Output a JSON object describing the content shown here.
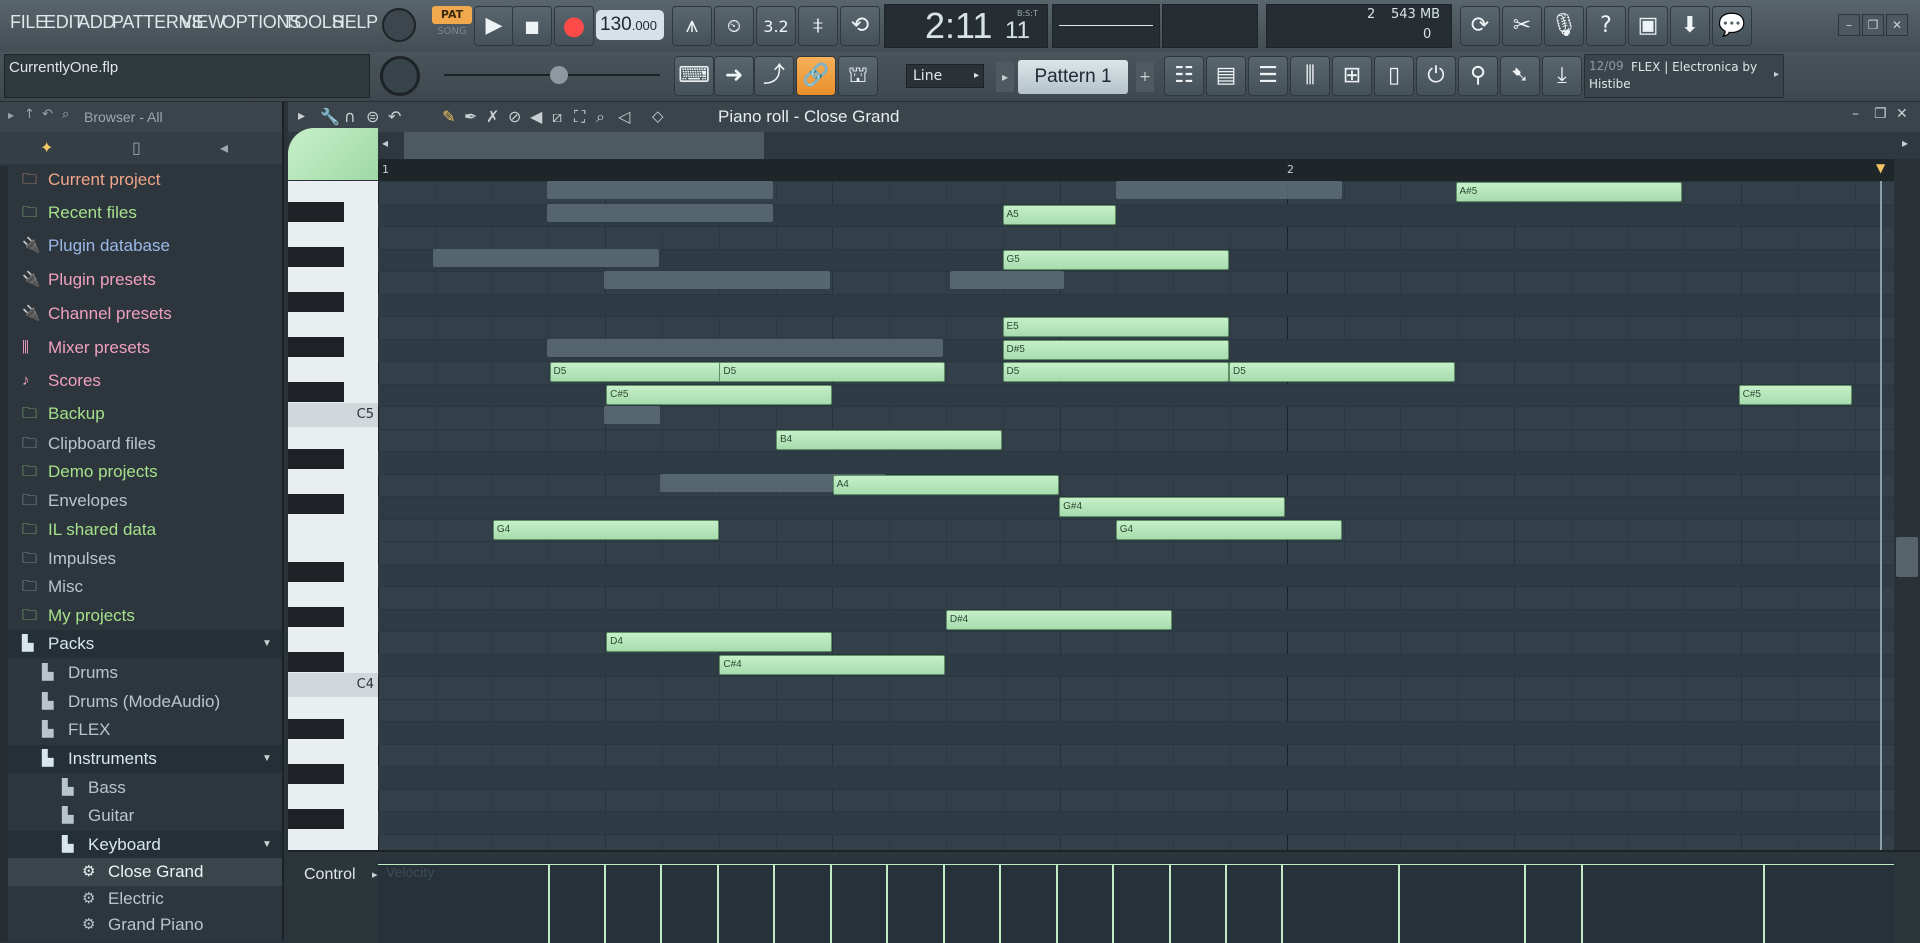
{
  "menu": [
    "FILE",
    "EDIT",
    "ADD",
    "PATTERNS",
    "VIEW",
    "OPTIONS",
    "TOOLS",
    "HELP"
  ],
  "transport": {
    "pat_label": "PAT",
    "song_label": "SONG",
    "tempo": "130",
    "tempo_decimals": ".000",
    "time": "2:11",
    "time_ticks": "11",
    "time_unit": "B:S:T"
  },
  "cpu": {
    "polyphony": "2",
    "memory": "543 MB",
    "cpu_value": "0"
  },
  "project": {
    "filename": "CurrentlyOne.flp"
  },
  "snap": {
    "mode": "Line"
  },
  "pattern": {
    "name": "Pattern 1"
  },
  "news": {
    "date": "12/09",
    "text": "FLEX | Electronica by Histibe"
  },
  "browser": {
    "header": "Browser - All",
    "items": [
      {
        "label": "Current project",
        "color": "#f0a58a",
        "icon": "folder-icon"
      },
      {
        "label": "Recent files",
        "color": "#a5e08a",
        "icon": "folder-icon"
      },
      {
        "label": "Plugin database",
        "color": "#9ab8e8",
        "icon": "plug-icon"
      },
      {
        "label": "Plugin presets",
        "color": "#f0a0c0",
        "icon": "plug-icon"
      },
      {
        "label": "Channel presets",
        "color": "#f0a0c0",
        "icon": "plug-icon"
      },
      {
        "label": "Mixer presets",
        "color": "#f0a0c0",
        "icon": "mixer-icon"
      },
      {
        "label": "Scores",
        "color": "#f0a0c0",
        "icon": "note-icon"
      },
      {
        "label": "Backup",
        "color": "#a5e08a",
        "icon": "folder-icon"
      },
      {
        "label": "Clipboard files",
        "color": "#b8c6cc",
        "icon": "folder-icon"
      },
      {
        "label": "Demo projects",
        "color": "#a5e08a",
        "icon": "folder-icon"
      },
      {
        "label": "Envelopes",
        "color": "#b8c6cc",
        "icon": "folder-icon"
      },
      {
        "label": "IL shared data",
        "color": "#a5e08a",
        "icon": "folder-icon"
      },
      {
        "label": "Impulses",
        "color": "#b8c6cc",
        "icon": "folder-icon"
      },
      {
        "label": "Misc",
        "color": "#b8c6cc",
        "icon": "folder-icon"
      },
      {
        "label": "My projects",
        "color": "#a5e08a",
        "icon": "folder-icon"
      },
      {
        "label": "Packs",
        "color": "#d8e6ee",
        "icon": "pack-icon"
      },
      {
        "label": "Drums",
        "color": "#b8c6cc",
        "icon": "pack-icon"
      },
      {
        "label": "Drums (ModeAudio)",
        "color": "#b8c6cc",
        "icon": "pack-icon"
      },
      {
        "label": "FLEX",
        "color": "#b8c6cc",
        "icon": "pack-icon"
      },
      {
        "label": "Instruments",
        "color": "#d8e6ee",
        "icon": "pack-icon"
      },
      {
        "label": "Bass",
        "color": "#b8c6cc",
        "icon": "pack-icon"
      },
      {
        "label": "Guitar",
        "color": "#b8c6cc",
        "icon": "pack-icon"
      },
      {
        "label": "Keyboard",
        "color": "#d8e6ee",
        "icon": "pack-icon"
      },
      {
        "label": "Close Grand",
        "color": "#eef3f5",
        "icon": "gear-icon"
      },
      {
        "label": "Electric",
        "color": "#b8c6cc",
        "icon": "gear-icon"
      },
      {
        "label": "Grand Piano",
        "color": "#b8c6cc",
        "icon": "gear-icon"
      }
    ]
  },
  "pianoroll": {
    "title": "Piano roll - Close Grand",
    "bar_labels": [
      "1",
      "2"
    ],
    "octave_labels": [
      "C5",
      "C4"
    ],
    "notes": [
      {
        "label": "A#5",
        "bar": "5.0",
        "len": "1.0",
        "row": "1"
      },
      {
        "label": "A5",
        "bar": "3.0",
        "len": "0.5",
        "row": "2"
      },
      {
        "label": "G5",
        "bar": "3.0",
        "len": "1.0",
        "row": "4"
      },
      {
        "label": "E5",
        "bar": "3.0",
        "len": "1.0",
        "row": "7"
      },
      {
        "label": "D#5",
        "bar": "3.0",
        "len": "1.0",
        "row": "8"
      },
      {
        "label": "D5",
        "bar": "1.0",
        "len": "1.0",
        "row": "9"
      },
      {
        "label": "D5",
        "bar": "1.75",
        "len": "1.0",
        "row": "9"
      },
      {
        "label": "D5",
        "bar": "3.0",
        "len": "1.0",
        "row": "9"
      },
      {
        "label": "D5",
        "bar": "4.0",
        "len": "1.0",
        "row": "9"
      },
      {
        "label": "C#5",
        "bar": "1.25",
        "len": "1.0",
        "row": "10"
      },
      {
        "label": "C#5",
        "bar": "6.25",
        "len": "0.5",
        "row": "10"
      },
      {
        "label": "B4",
        "bar": "2.0",
        "len": "1.0",
        "row": "12"
      },
      {
        "label": "A4",
        "bar": "2.25",
        "len": "1.0",
        "row": "14"
      },
      {
        "label": "G#4",
        "bar": "3.25",
        "len": "1.0",
        "row": "15"
      },
      {
        "label": "G4",
        "bar": "0.75",
        "len": "1.0",
        "row": "16"
      },
      {
        "label": "G4",
        "bar": "3.5",
        "len": "1.0",
        "row": "16"
      },
      {
        "label": "D#4",
        "bar": "2.75",
        "len": "1.0",
        "row": "20"
      },
      {
        "label": "D4",
        "bar": "1.25",
        "len": "1.0",
        "row": "21"
      },
      {
        "label": "C#4",
        "bar": "1.75",
        "len": "1.0",
        "row": "22"
      }
    ]
  },
  "control": {
    "label": "Control",
    "param": "Velocity"
  }
}
